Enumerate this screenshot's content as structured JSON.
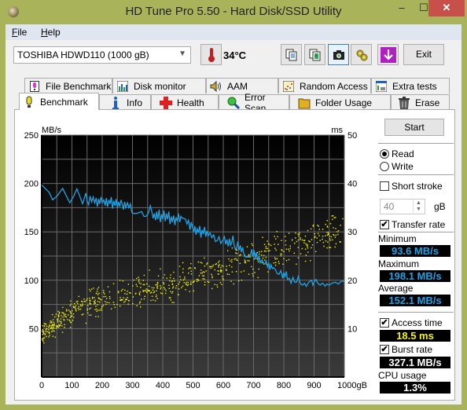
{
  "window": {
    "title": "HD Tune Pro 5.50 - Hard Disk/SSD Utility",
    "minimize_glyph": "–",
    "maximize_glyph": "☐",
    "close_glyph": "✕"
  },
  "menu": {
    "file": {
      "accel": "F",
      "rest": "ile"
    },
    "help": {
      "accel": "H",
      "rest": "elp"
    }
  },
  "toolbar": {
    "drive": "TOSHIBA HDWD110 (1000 gB)",
    "temperature": "34°C",
    "buttons": [
      "copy-text-icon",
      "copy-image-icon",
      "screenshot-camera-icon",
      "options-gears-icon",
      "save-download-icon"
    ],
    "exit_label": "Exit"
  },
  "tabs": {
    "top": [
      {
        "label": "File Benchmark",
        "icon": "file-benchmark-icon"
      },
      {
        "label": "Disk monitor",
        "icon": "disk-monitor-icon"
      },
      {
        "label": "AAM",
        "icon": "speaker-icon"
      },
      {
        "label": "Random Access",
        "icon": "random-access-icon"
      },
      {
        "label": "Extra tests",
        "icon": "extra-tests-icon"
      }
    ],
    "bottom": [
      {
        "label": "Benchmark",
        "icon": "benchmark-bulb-icon",
        "selected": true
      },
      {
        "label": "Info",
        "icon": "info-icon"
      },
      {
        "label": "Health",
        "icon": "health-cross-icon"
      },
      {
        "label": "Error Scan",
        "icon": "magnifier-icon"
      },
      {
        "label": "Folder Usage",
        "icon": "folder-icon"
      },
      {
        "label": "Erase",
        "icon": "trash-icon"
      }
    ]
  },
  "side": {
    "start_label": "Start",
    "read_label": "Read",
    "write_label": "Write",
    "mode": "read",
    "short_stroke_label": "Short stroke",
    "short_stroke_checked": false,
    "short_stroke_value": "40",
    "short_stroke_unit": "gB",
    "transfer_rate_label": "Transfer rate",
    "transfer_rate_checked": true,
    "minimum_label": "Minimum",
    "minimum_value": "93.6 MB/s",
    "maximum_label": "Maximum",
    "maximum_value": "198.1 MB/s",
    "average_label": "Average",
    "average_value": "152.1 MB/s",
    "access_time_label": "Access time",
    "access_time_checked": true,
    "access_time_value": "18.5 ms",
    "burst_rate_label": "Burst rate",
    "burst_rate_checked": true,
    "burst_rate_value": "327.1 MB/s",
    "cpu_label": "CPU usage",
    "cpu_value": "1.3%"
  },
  "chart_data": {
    "type": "line",
    "title": "",
    "xlabel": "gB",
    "ylabel_left": "MB/s",
    "ylabel_right": "ms",
    "xlim": [
      0,
      1000
    ],
    "ylim_left": [
      0,
      250
    ],
    "ylim_right": [
      0,
      50
    ],
    "x_ticks": [
      "0",
      "100",
      "200",
      "300",
      "400",
      "500",
      "600",
      "700",
      "800",
      "900",
      "1000gB"
    ],
    "y_ticks_left": [
      "250",
      "200",
      "150",
      "100",
      "50"
    ],
    "y_ticks_right": [
      "50",
      "40",
      "30",
      "20",
      "10"
    ],
    "grid": true,
    "colors": {
      "transfer": "#1fa3e6",
      "access": "#f4f400",
      "bg_top": "#000000",
      "bg_bottom": "#3a3a3a",
      "grid": "#6a6a6a"
    },
    "series": [
      {
        "name": "Transfer rate (MB/s)",
        "axis": "left",
        "points": [
          [
            0,
            198.5
          ],
          [
            12,
            194.7
          ],
          [
            25,
            190.7
          ],
          [
            36,
            183
          ],
          [
            51,
            187
          ],
          [
            69,
            195
          ],
          [
            85,
            185
          ],
          [
            93,
            180
          ],
          [
            106,
            187
          ],
          [
            116,
            194.5
          ],
          [
            127,
            186
          ],
          [
            135,
            179
          ],
          [
            141,
            185
          ],
          [
            146,
            190
          ],
          [
            150,
            182
          ],
          [
            155,
            178
          ],
          [
            160,
            187
          ],
          [
            165,
            181
          ],
          [
            170,
            186
          ],
          [
            175,
            180
          ],
          [
            180,
            185
          ],
          [
            184,
            176
          ],
          [
            188,
            184
          ],
          [
            192,
            179
          ],
          [
            196,
            186
          ],
          [
            200,
            180
          ],
          [
            205,
            183
          ],
          [
            210,
            177
          ],
          [
            214,
            185
          ],
          [
            218,
            176
          ],
          [
            222,
            183
          ],
          [
            226,
            179
          ],
          [
            230,
            186
          ],
          [
            234,
            174
          ],
          [
            238,
            182
          ],
          [
            242,
            177
          ],
          [
            246,
            184
          ],
          [
            250,
            175
          ],
          [
            254,
            181
          ],
          [
            258,
            176
          ],
          [
            262,
            183
          ],
          [
            266,
            179
          ],
          [
            270,
            173
          ],
          [
            274,
            181
          ],
          [
            278,
            175
          ],
          [
            283,
            180
          ],
          [
            288,
            175
          ],
          [
            293,
            179
          ],
          [
            298,
            170
          ],
          [
            304,
            169
          ],
          [
            312,
            169
          ],
          [
            322,
            170
          ],
          [
            330,
            171
          ],
          [
            338,
            166
          ],
          [
            345,
            166
          ],
          [
            352,
            169
          ],
          [
            359,
            177
          ],
          [
            364,
            171
          ],
          [
            368,
            164
          ],
          [
            372,
            169
          ],
          [
            376,
            162
          ],
          [
            380,
            171
          ],
          [
            384,
            163
          ],
          [
            388,
            173
          ],
          [
            392,
            160
          ],
          [
            396,
            168
          ],
          [
            400,
            163
          ],
          [
            404,
            172
          ],
          [
            408,
            161
          ],
          [
            412,
            169
          ],
          [
            416,
            163
          ],
          [
            420,
            171
          ],
          [
            424,
            158
          ],
          [
            428,
            166
          ],
          [
            432,
            160
          ],
          [
            436,
            167
          ],
          [
            440,
            157
          ],
          [
            444,
            165
          ],
          [
            448,
            161
          ],
          [
            452,
            169
          ],
          [
            456,
            160
          ],
          [
            460,
            166
          ],
          [
            465,
            164
          ],
          [
            470,
            164
          ],
          [
            475,
            163
          ],
          [
            480,
            158
          ],
          [
            485,
            162
          ],
          [
            490,
            152
          ],
          [
            494,
            160
          ],
          [
            498,
            156
          ],
          [
            502,
            150
          ],
          [
            506,
            156
          ],
          [
            510,
            147
          ],
          [
            514,
            153
          ],
          [
            518,
            149
          ],
          [
            522,
            156
          ],
          [
            526,
            144
          ],
          [
            530,
            152
          ],
          [
            534,
            148
          ],
          [
            538,
            155
          ],
          [
            542,
            145
          ],
          [
            546,
            151
          ],
          [
            550,
            146
          ],
          [
            556,
            149
          ],
          [
            562,
            144
          ],
          [
            568,
            147
          ],
          [
            574,
            140
          ],
          [
            580,
            141
          ],
          [
            586,
            145
          ],
          [
            592,
            138
          ],
          [
            598,
            141
          ],
          [
            604,
            145
          ],
          [
            608,
            137
          ],
          [
            612,
            142
          ],
          [
            616,
            135
          ],
          [
            620,
            143
          ],
          [
            624,
            136
          ],
          [
            628,
            139
          ],
          [
            632,
            146
          ],
          [
            636,
            136
          ],
          [
            640,
            132
          ],
          [
            644,
            133
          ],
          [
            648,
            140
          ],
          [
            652,
            131
          ],
          [
            656,
            136
          ],
          [
            660,
            129
          ],
          [
            664,
            134
          ],
          [
            668,
            127
          ],
          [
            672,
            124
          ],
          [
            678,
            124
          ],
          [
            684,
            124
          ],
          [
            690,
            126
          ],
          [
            694,
            132
          ],
          [
            698,
            124
          ],
          [
            702,
            131
          ],
          [
            706,
            122
          ],
          [
            710,
            129
          ],
          [
            714,
            120
          ],
          [
            718,
            125
          ],
          [
            722,
            118
          ],
          [
            728,
            121
          ],
          [
            734,
            117
          ],
          [
            738,
            117
          ],
          [
            742,
            120
          ],
          [
            746,
            114
          ],
          [
            750,
            118
          ],
          [
            754,
            111
          ],
          [
            758,
            116
          ],
          [
            762,
            112
          ],
          [
            766,
            113
          ],
          [
            772,
            111
          ],
          [
            778,
            107
          ],
          [
            784,
            106
          ],
          [
            790,
            110
          ],
          [
            796,
            102
          ],
          [
            800,
            108
          ],
          [
            804,
            104
          ],
          [
            808,
            109
          ],
          [
            812,
            101
          ],
          [
            818,
            102
          ],
          [
            824,
            97
          ],
          [
            830,
            103
          ],
          [
            836,
            98
          ],
          [
            842,
            98
          ],
          [
            848,
            104
          ],
          [
            852,
            99
          ],
          [
            856,
            96
          ],
          [
            862,
            95
          ],
          [
            868,
            97
          ],
          [
            874,
            93.6
          ],
          [
            880,
            97
          ],
          [
            886,
            99
          ],
          [
            892,
            100
          ],
          [
            896,
            95
          ],
          [
            900,
            98
          ],
          [
            906,
            101
          ],
          [
            912,
            97
          ],
          [
            920,
            95
          ],
          [
            928,
            97
          ],
          [
            936,
            94
          ],
          [
            942,
            96
          ],
          [
            950,
            95
          ],
          [
            960,
            97
          ],
          [
            970,
            98
          ],
          [
            980,
            96
          ],
          [
            990,
            99
          ],
          [
            1000,
            99
          ]
        ]
      },
      {
        "name": "Access time (ms)",
        "axis": "right",
        "style": "scatter",
        "trend": {
          "x": [
            0,
            100,
            200,
            300,
            400,
            500,
            600,
            700,
            800,
            900,
            1000
          ],
          "center_ms": [
            9,
            13.5,
            16,
            17.5,
            19,
            20.5,
            22.5,
            24.5,
            26.5,
            29,
            30
          ],
          "spread_ms": [
            3,
            4,
            4.5,
            4.5,
            4.5,
            5,
            5,
            5,
            5.5,
            6,
            6
          ]
        },
        "count": 700,
        "average_ms": 18.5
      }
    ]
  }
}
